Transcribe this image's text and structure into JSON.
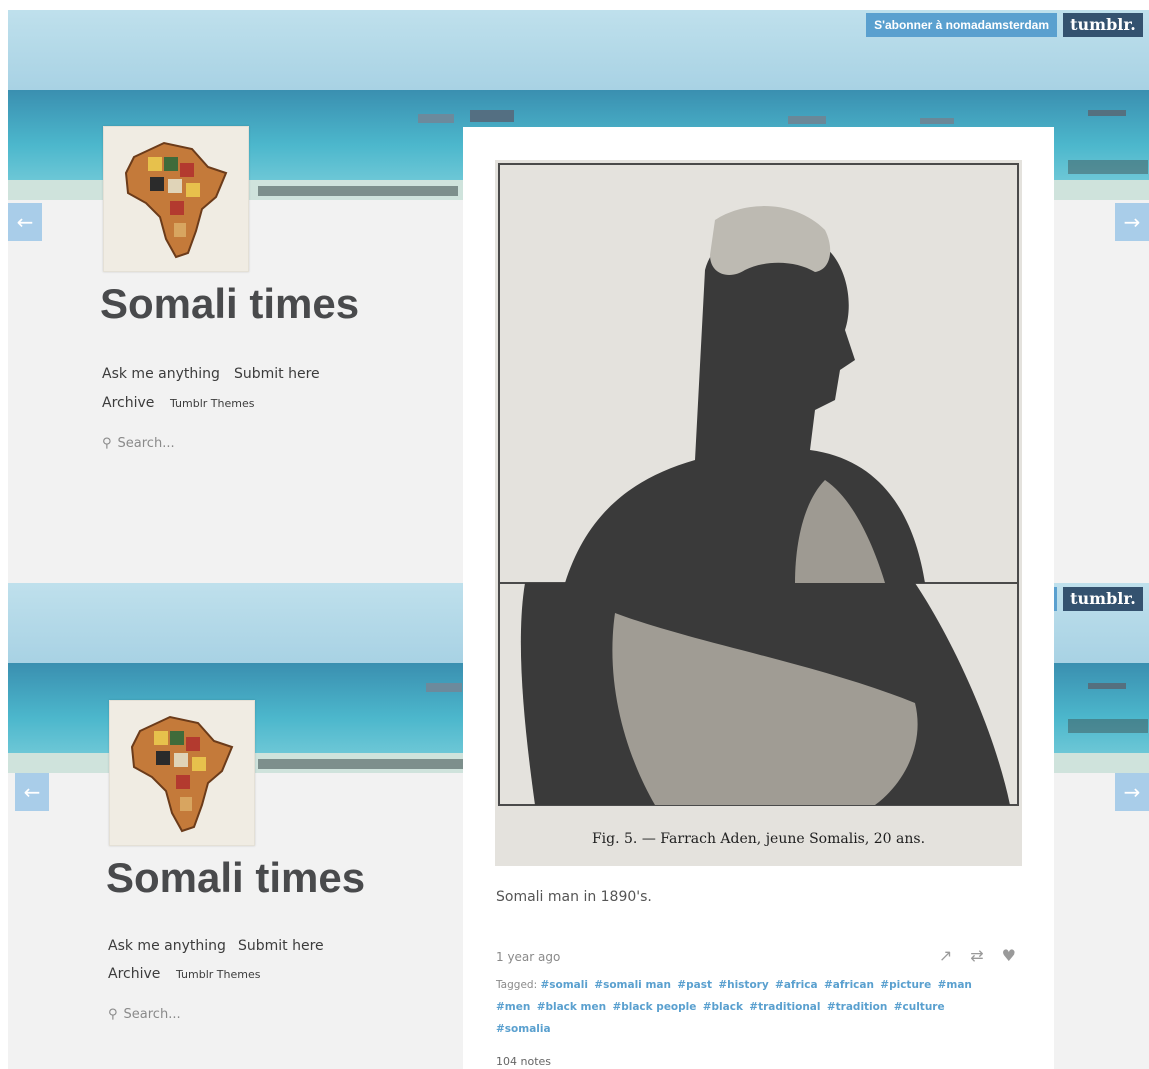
{
  "header": {
    "subscribe_label": "S'abonner à nomadamsterdam",
    "logo_text": "tumblr."
  },
  "nav": {
    "prev_glyph": "←",
    "next_glyph": "→",
    "prev_icon": "arrow-left-icon",
    "next_icon": "arrow-right-icon"
  },
  "blog": {
    "title": "Somali times",
    "links": {
      "ask": "Ask me anything",
      "submit": "Submit here",
      "archive": "Archive",
      "themes": "Tumblr Themes"
    },
    "search_placeholder": "Search..."
  },
  "post": {
    "figure_caption": "Fig. 5. — Farrach Aden, jeune Somalis, 20 ans.",
    "text": "Somali man in 1890's.",
    "date": "1 year ago",
    "tagged_label": "Tagged:",
    "tags": [
      "#somali",
      "#somali man",
      "#past",
      "#history",
      "#africa",
      "#african",
      "#picture",
      "#man",
      "#men",
      "#black men",
      "#black people",
      "#black",
      "#traditional",
      "#tradition",
      "#culture",
      "#somalia"
    ],
    "notes": "104 notes",
    "action_icons": [
      "share-icon",
      "reblog-icon",
      "like-icon"
    ]
  },
  "colors": {
    "accent": "#5aa0cf",
    "logo_bg": "#34526f",
    "arrow_bg": "#a9cde9",
    "sea": "#4bb3c9",
    "page_bg": "#f2f2f2"
  }
}
